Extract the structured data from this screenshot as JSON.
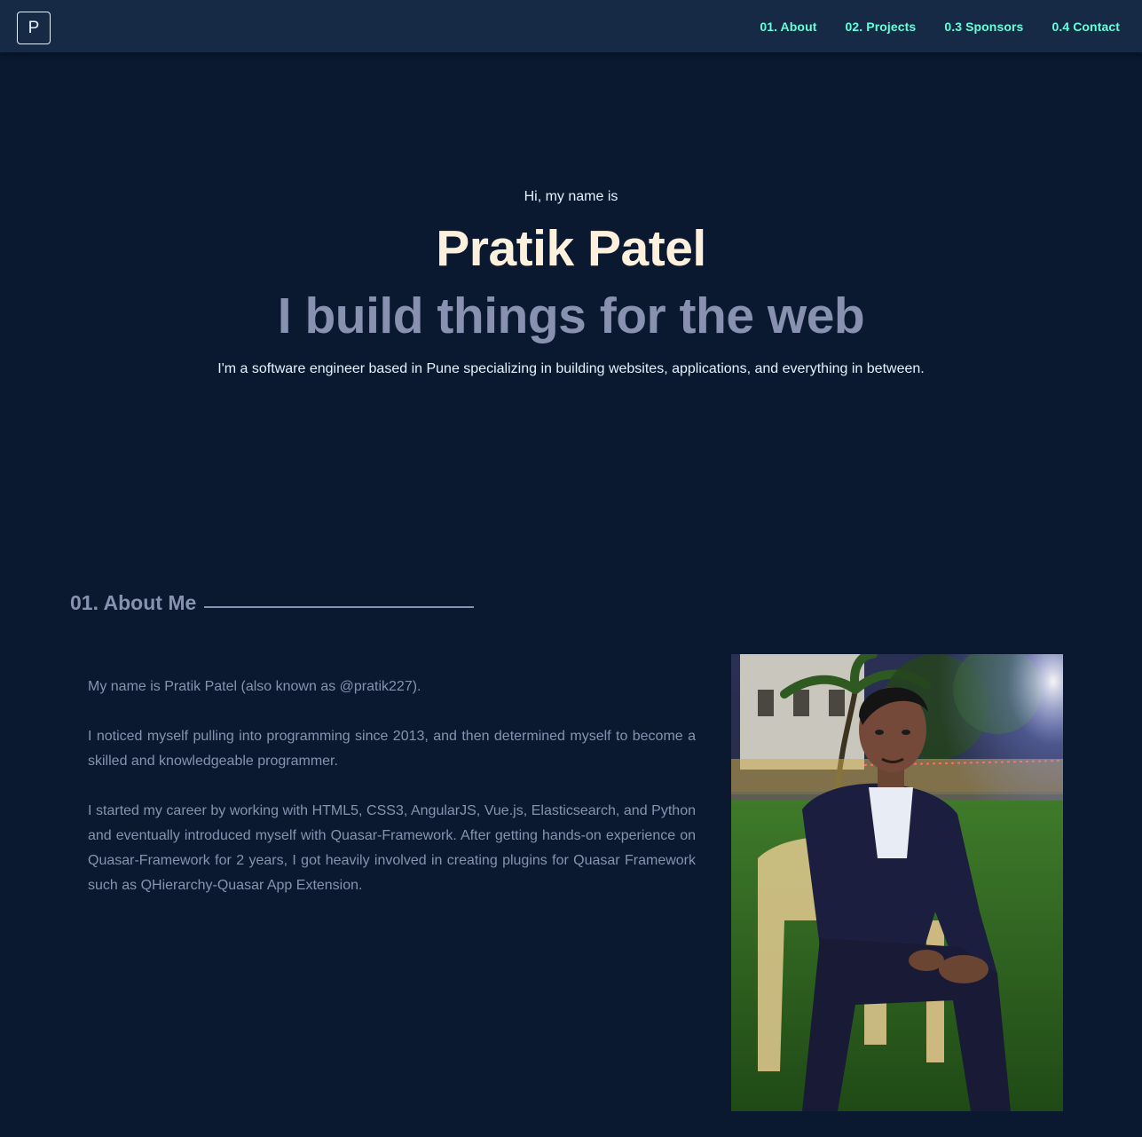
{
  "nav": {
    "logo_letter": "P",
    "links": [
      {
        "label": "01. About"
      },
      {
        "label": "02. Projects"
      },
      {
        "label": "0.3 Sponsors"
      },
      {
        "label": "0.4 Contact"
      }
    ]
  },
  "hero": {
    "greeting": "Hi, my name is",
    "name": "Pratik Patel",
    "tagline": "I build things for the web",
    "description": "I'm a software engineer based in Pune specializing in building websites, applications, and everything in between."
  },
  "about": {
    "heading": "01. About Me",
    "paragraphs": [
      "My name is Pratik Patel (also known as @pratik227).",
      "I noticed myself pulling into programming since 2013, and then determined myself to become a skilled and knowledgeable programmer.",
      "I started my career by working with HTML5, CSS3, AngularJS, Vue.js, Elasticsearch, and Python and eventually introduced myself with Quasar-Framework. After getting hands-on experience on Quasar-Framework for 2 years, I got heavily involved in creating plugins for Quasar Framework such as QHierarchy-Quasar App Extension."
    ]
  },
  "colors": {
    "background": "#0a192f",
    "navbar": "#172a45",
    "accent": "#64ffda",
    "name": "#fdf1dd",
    "slate": "#8892b0",
    "light": "#e6f1ff"
  }
}
